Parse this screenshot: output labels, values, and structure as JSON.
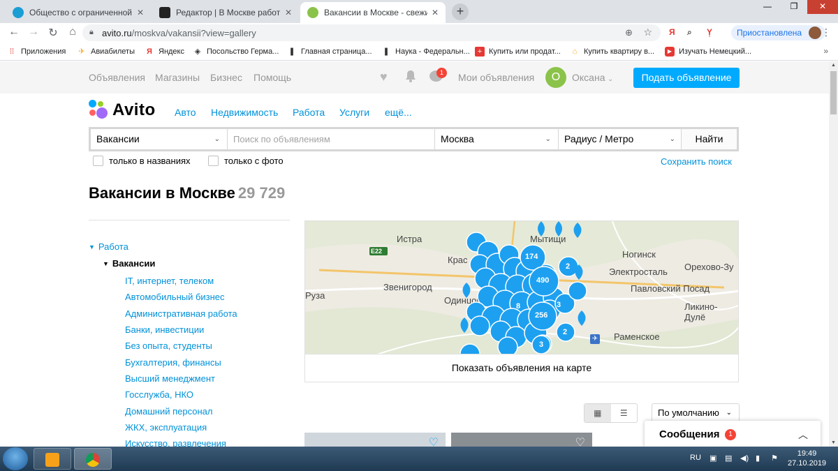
{
  "browser": {
    "tabs": [
      {
        "title": "Общество с ограниченной отв",
        "fav_color": "#1a9ed4",
        "active": false
      },
      {
        "title": "Редактор | В Москве работы ва",
        "fav_color": "#222222",
        "active": false
      },
      {
        "title": "Вакансии в Москве - свежие об",
        "fav_color": "#8bc34a",
        "active": true
      }
    ],
    "url_host": "avito.ru",
    "url_path": "/moskva/vakansii?view=gallery",
    "paused_label": "Приостановлена",
    "bookmarks": [
      {
        "label": "Приложения",
        "icon": "apps-grid-icon"
      },
      {
        "label": "Авиабилеты",
        "icon": "plane-icon"
      },
      {
        "label": "Яндекс",
        "icon": "yandex-icon"
      },
      {
        "label": "Посольство Герма...",
        "icon": "embassy-icon"
      },
      {
        "label": "Главная страница...",
        "icon": "flag-icon"
      },
      {
        "label": "Наука - Федеральн...",
        "icon": "flag-icon"
      },
      {
        "label": "Купить или продат...",
        "icon": "swiss-icon"
      },
      {
        "label": "Купить квартиру в...",
        "icon": "house-icon"
      },
      {
        "label": "Изучать Немецкий...",
        "icon": "youtube-icon"
      }
    ]
  },
  "header": {
    "links": [
      "Объявления",
      "Магазины",
      "Бизнес",
      "Помощь"
    ],
    "messages_badge": "1",
    "my_ads": "Мои объявления",
    "avatar_letter": "О",
    "user_name": "Оксана",
    "post_button": "Подать объявление"
  },
  "logo": {
    "text": "Avito"
  },
  "categories": [
    "Авто",
    "Недвижимость",
    "Работа",
    "Услуги",
    "ещё..."
  ],
  "search": {
    "category": "Вакансии",
    "query_placeholder": "Поиск по объявлениям",
    "location": "Москва",
    "radius": "Радиус / Метро",
    "submit": "Найти",
    "only_titles": "только в названиях",
    "only_photo": "только с фото",
    "save_search": "Сохранить поиск"
  },
  "page_title": {
    "text": "Вакансии в Москве",
    "count": "29 729"
  },
  "sidebar": {
    "section": "Работа",
    "subsection": "Вакансии",
    "items": [
      "IT, интернет, телеком",
      "Автомобильный бизнес",
      "Административная работа",
      "Банки, инвестиции",
      "Без опыта, студенты",
      "Бухгалтерия, финансы",
      "Высший менеджмент",
      "Госслужба, НКО",
      "Домашний персонал",
      "ЖКХ, эксплуатация",
      "Искусство, развлечения"
    ]
  },
  "map": {
    "places": [
      "Истра",
      "Мытищи",
      "Ногинск",
      "Электросталь",
      "Орехово-Зу",
      "Звенигород",
      "Павловский Посад",
      "Руза",
      "Одинцово",
      "Ликино-Дулё",
      "Раменское",
      "Крас"
    ],
    "road_label": "E22",
    "cluster_counts": [
      "174",
      "490",
      "256",
      "2",
      "2",
      "3",
      "8",
      "3"
    ],
    "show_button": "Показать объявления на карте",
    "pin_color": "#1ea0f0"
  },
  "listing_controls": {
    "sort": "По умолчанию"
  },
  "messenger": {
    "title": "Сообщения",
    "count": "1"
  },
  "taskbar": {
    "lang": "RU",
    "time": "19:49",
    "date": "27.10.2019"
  }
}
